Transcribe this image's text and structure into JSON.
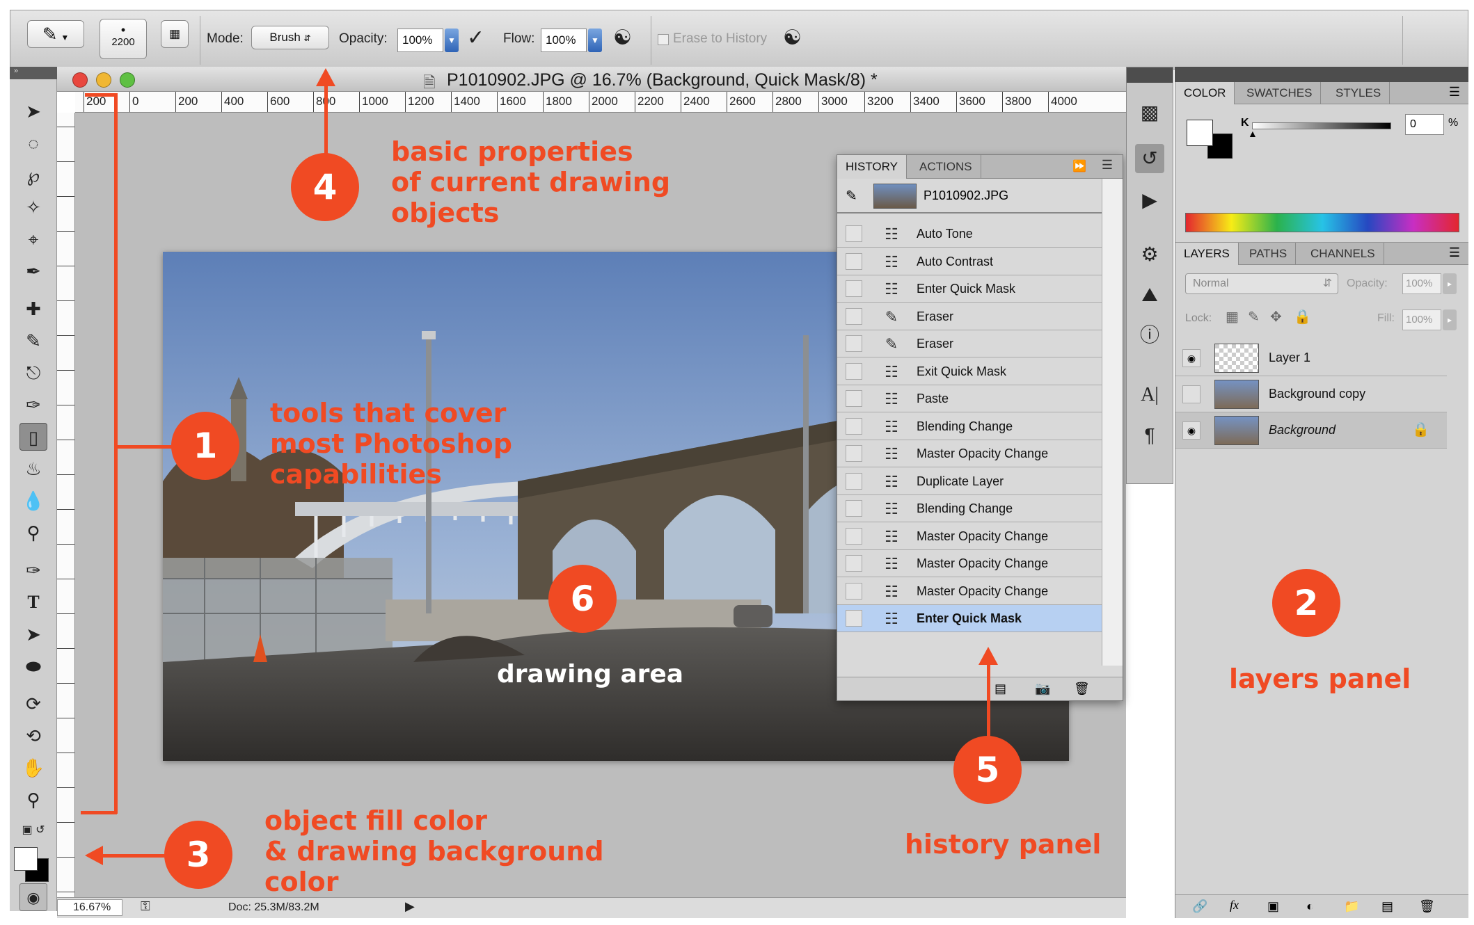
{
  "options_bar": {
    "brush_size": "2200",
    "mode_label": "Mode:",
    "mode_value": "Brush",
    "opacity_label": "Opacity:",
    "opacity_value": "100%",
    "flow_label": "Flow:",
    "flow_value": "100%",
    "erase_history_label": "Erase to History"
  },
  "document": {
    "title": "P1010902.JPG @ 16.7% (Background, Quick Mask/8) *",
    "ruler_marks": [
      "200",
      "0",
      "200",
      "400",
      "600",
      "800",
      "1000",
      "1200",
      "1400",
      "1600",
      "1800",
      "2000",
      "2200",
      "2400",
      "2600",
      "2800",
      "3000",
      "3200",
      "3400",
      "3600",
      "3800",
      "4000"
    ]
  },
  "status_bar": {
    "zoom": "16.67%",
    "doc_size": "Doc: 25.3M/83.2M"
  },
  "history_panel": {
    "tabs": [
      "HISTORY",
      "ACTIONS"
    ],
    "snapshot_name": "P1010902.JPG",
    "items": [
      {
        "label": "Auto Tone",
        "icon": "doc-icon"
      },
      {
        "label": "Auto Contrast",
        "icon": "doc-icon"
      },
      {
        "label": "Enter Quick Mask",
        "icon": "doc-icon"
      },
      {
        "label": "Eraser",
        "icon": "eraser-icon"
      },
      {
        "label": "Eraser",
        "icon": "eraser-icon"
      },
      {
        "label": "Exit Quick Mask",
        "icon": "doc-icon"
      },
      {
        "label": "Paste",
        "icon": "doc-icon"
      },
      {
        "label": "Blending Change",
        "icon": "doc-icon"
      },
      {
        "label": "Master Opacity Change",
        "icon": "doc-icon"
      },
      {
        "label": "Duplicate Layer",
        "icon": "doc-icon"
      },
      {
        "label": "Blending Change",
        "icon": "doc-icon"
      },
      {
        "label": "Master Opacity Change",
        "icon": "doc-icon"
      },
      {
        "label": "Master Opacity Change",
        "icon": "doc-icon"
      },
      {
        "label": "Master Opacity Change",
        "icon": "doc-icon"
      },
      {
        "label": "Enter Quick Mask",
        "icon": "doc-icon",
        "selected": true
      }
    ]
  },
  "color_panel": {
    "tabs": [
      "COLOR",
      "SWATCHES",
      "STYLES"
    ],
    "channel_label": "K",
    "channel_value": "0",
    "unit": "%"
  },
  "layers_panel": {
    "tabs": [
      "LAYERS",
      "PATHS",
      "CHANNELS"
    ],
    "blend_mode": "Normal",
    "opacity_label": "Opacity:",
    "opacity_value": "100%",
    "lock_label": "Lock:",
    "fill_label": "Fill:",
    "fill_value": "100%",
    "layers": [
      {
        "name": "Layer 1",
        "visible": true
      },
      {
        "name": "Background copy",
        "visible": false
      },
      {
        "name": "Background",
        "visible": true,
        "locked": true
      }
    ]
  },
  "annotations": {
    "n1": "1",
    "n2": "2",
    "n3": "3",
    "n4": "4",
    "n5": "5",
    "n6": "6",
    "tools_l1": "tools that cover",
    "tools_l2": "most Photoshop",
    "tools_l3": "capabilities",
    "props_l1": "basic properties",
    "props_l2": "of current drawing",
    "props_l3": "objects",
    "fill_l1": "object fill color",
    "fill_l2": "& drawing background",
    "fill_l3": "color",
    "drawing_area": "drawing area",
    "history_panel": "history panel",
    "layers_panel": "layers panel"
  },
  "colors": {
    "annotation": "#f04a23",
    "selection": "#b7d0f2"
  }
}
